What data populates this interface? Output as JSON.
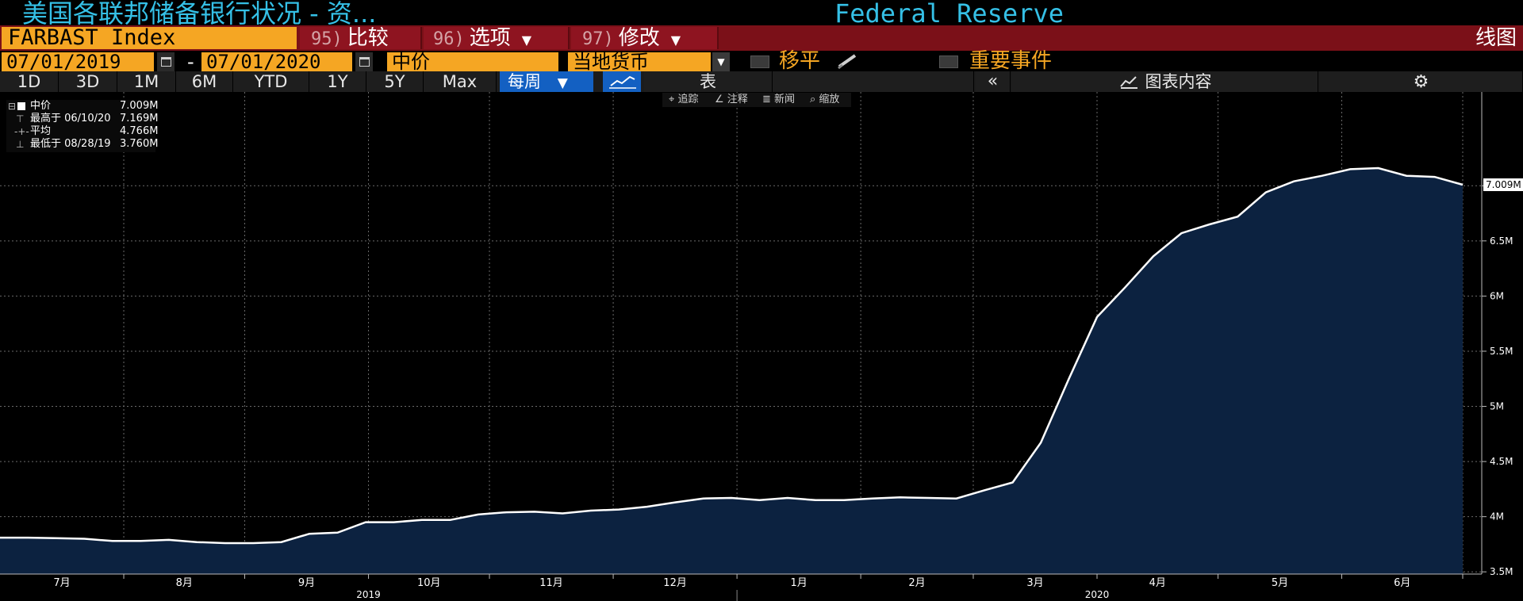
{
  "header": {
    "title_cn": "美国各联邦储备银行状况 - 资...",
    "title_en": "Federal Reserve"
  },
  "toolbar": {
    "ticker": "FARBAST Index",
    "compare": {
      "num": "95)",
      "label": "比较"
    },
    "options": {
      "num": "96)",
      "label": "选项"
    },
    "modify": {
      "num": "97)",
      "label": "修改"
    },
    "chart_type": "线图"
  },
  "settings": {
    "start_date": "07/01/2019",
    "date_sep": "-",
    "end_date": "07/01/2020",
    "price_field": "中价",
    "currency": "当地货币",
    "moving_avg_label": "移平",
    "key_events_label": "重要事件"
  },
  "periods": {
    "items": [
      "1D",
      "3D",
      "1M",
      "6M",
      "YTD",
      "1Y",
      "5Y",
      "Max"
    ],
    "frequency": "每周",
    "table_label": "表",
    "chart_content_label": "图表内容"
  },
  "chart_tools": {
    "track": "追踪",
    "annotate": "注释",
    "news": "新闻",
    "zoom": "缩放"
  },
  "legend": {
    "series_name": "中价",
    "series_value": "7.009M",
    "high_label": "最高于 06/10/20",
    "high_value": "7.169M",
    "avg_label": "平均",
    "avg_value": "4.766M",
    "low_label": "最低于 08/28/19",
    "low_value": "3.760M"
  },
  "colors": {
    "accent_orange": "#f5a623",
    "title_cyan": "#35c0e6",
    "bar_red": "#7b1018",
    "area_fill": "#0c2240",
    "line": "#ffffff"
  },
  "chart_data": {
    "type": "area",
    "title": "",
    "xlabel": "",
    "ylabel": "",
    "last_value_label": "7.009M",
    "ylim": [
      3.48,
      7.85
    ],
    "y_ticks": [
      3.5,
      4,
      4.5,
      5,
      5.5,
      6,
      6.5,
      7
    ],
    "y_tick_labels": [
      "3.5M",
      "4M",
      "4.5M",
      "5M",
      "5.5M",
      "6M",
      "6.5M"
    ],
    "x_month_labels": [
      "7月",
      "8月",
      "9月",
      "10月",
      "11月",
      "12月",
      "1月",
      "2月",
      "3月",
      "4月",
      "5月",
      "6月"
    ],
    "x_year_labels": [
      "2019",
      "2020"
    ],
    "grid": true,
    "series": [
      {
        "values": [
          3.81,
          3.81,
          3.805,
          3.8,
          3.78,
          3.78,
          3.79,
          3.77,
          3.76,
          3.76,
          3.77,
          3.845,
          3.855,
          3.95,
          3.95,
          3.97,
          3.97,
          4.02,
          4.04,
          4.045,
          4.03,
          4.055,
          4.065,
          4.09,
          4.13,
          4.165,
          4.17,
          4.15,
          4.17,
          4.15,
          4.15,
          4.165,
          4.175,
          4.17,
          4.165,
          4.24,
          4.31,
          4.67,
          5.25,
          5.81,
          6.08,
          6.36,
          6.57,
          6.65,
          6.72,
          6.94,
          7.04,
          7.09,
          7.15,
          7.16,
          7.09,
          7.08,
          7.009
        ]
      }
    ]
  }
}
